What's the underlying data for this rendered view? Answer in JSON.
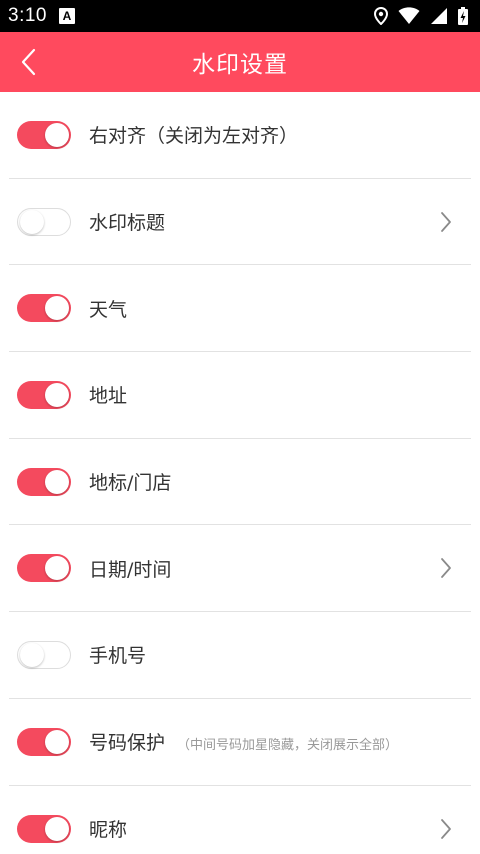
{
  "status_bar": {
    "time": "3:10",
    "notification_glyph": "A",
    "icons": [
      "location-icon",
      "wifi-icon",
      "signal-icon",
      "battery-charging-icon"
    ]
  },
  "app_bar": {
    "title": "水印设置",
    "back_icon": "chevron-left-icon"
  },
  "colors": {
    "accent": "#ff4a5e",
    "toggle_on": "#f44a5e",
    "divider": "#e2e2e2",
    "text": "#333333",
    "hint": "#999999"
  },
  "settings": [
    {
      "label": "右对齐（关闭为左对齐）",
      "enabled": true,
      "has_chevron": false,
      "hint": ""
    },
    {
      "label": "水印标题",
      "enabled": false,
      "has_chevron": true,
      "hint": ""
    },
    {
      "label": "天气",
      "enabled": true,
      "has_chevron": false,
      "hint": ""
    },
    {
      "label": "地址",
      "enabled": true,
      "has_chevron": false,
      "hint": ""
    },
    {
      "label": "地标/门店",
      "enabled": true,
      "has_chevron": false,
      "hint": ""
    },
    {
      "label": "日期/时间",
      "enabled": true,
      "has_chevron": true,
      "hint": ""
    },
    {
      "label": "手机号",
      "enabled": false,
      "has_chevron": false,
      "hint": ""
    },
    {
      "label": "号码保护",
      "enabled": true,
      "has_chevron": false,
      "hint": "（中间号码加星隐藏，关闭展示全部）"
    },
    {
      "label": "昵称",
      "enabled": true,
      "has_chevron": true,
      "hint": ""
    }
  ]
}
